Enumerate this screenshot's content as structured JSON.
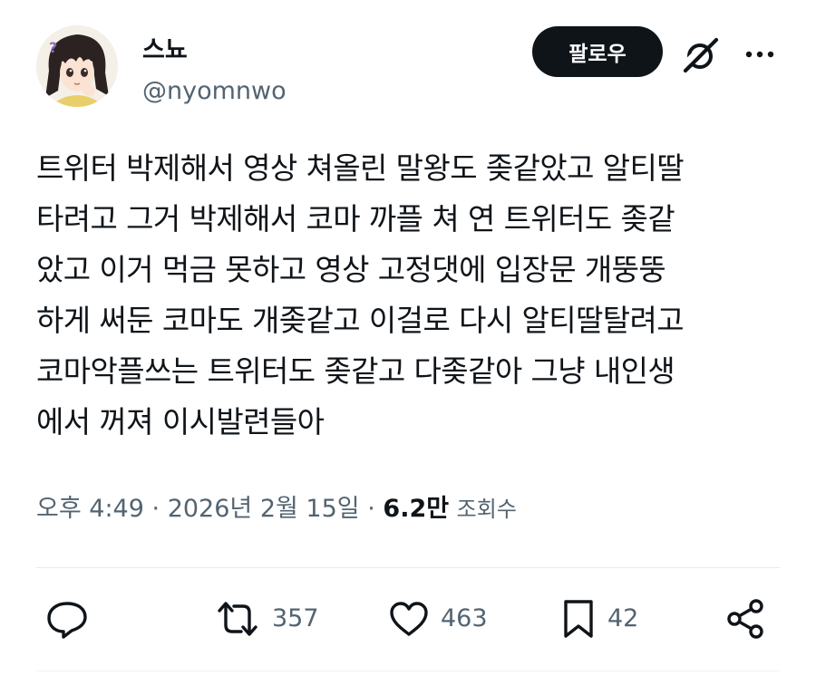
{
  "author": {
    "display_name": "스뇨",
    "handle": "@nyomnwo",
    "avatar_icon": "anime-avatar-icon"
  },
  "header": {
    "follow_label": "팔로우",
    "grok_icon": "grok-icon",
    "more_icon": "more-options-icon"
  },
  "tweet": {
    "lines": [
      "트위터 박제해서 영상 쳐올린 말왕도 좆같았고 알티딸",
      "타려고 그거 박제해서 코마 까플 쳐 연 트위터도 좆같",
      "았고 이거 먹금 못하고 영상 고정댓에 입장문 개뚱뚱",
      "하게 써둔 코마도 개좆같고 이걸로 다시 알티딸탈려고",
      "코마악플쓰는 트위터도 좆같고 다좆같아 그냥 내인생",
      "에서 꺼져 이시발련들아"
    ]
  },
  "meta": {
    "time": "오후 4:49",
    "date": "2026년 2월 15일",
    "separator": "·",
    "views_count": "6.2만",
    "views_label": "조회수"
  },
  "actions": {
    "reply": {
      "icon": "reply-icon",
      "count": ""
    },
    "retweet": {
      "icon": "retweet-icon",
      "count": "357"
    },
    "like": {
      "icon": "heart-icon",
      "count": "463"
    },
    "bookmark": {
      "icon": "bookmark-icon",
      "count": "42"
    },
    "share": {
      "icon": "share-icon",
      "count": ""
    }
  },
  "colors": {
    "text_primary": "#0f1419",
    "text_secondary": "#536471",
    "follow_button_bg": "#0f1419",
    "divider": "#e6ecf0"
  }
}
